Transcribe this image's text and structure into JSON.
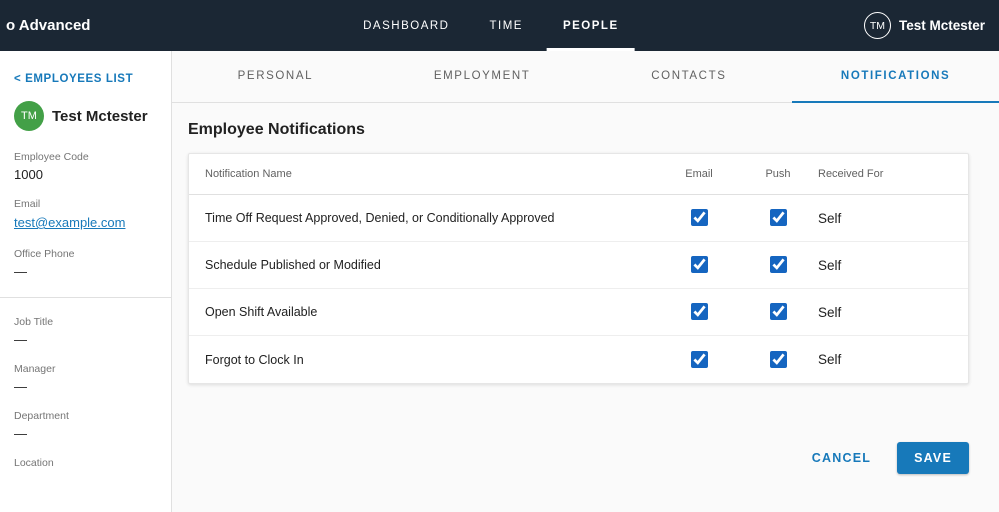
{
  "topbar": {
    "brand": "o Advanced",
    "nav": [
      {
        "label": "DASHBOARD",
        "active": false
      },
      {
        "label": "TIME",
        "active": false
      },
      {
        "label": "PEOPLE",
        "active": true
      }
    ],
    "user": {
      "initials": "TM",
      "name": "Test Mctester"
    }
  },
  "sidebar": {
    "back_link": "< EMPLOYEES LIST",
    "avatar_initials": "TM",
    "employee_name": "Test Mctester",
    "fields": [
      {
        "label": "Employee Code",
        "value": "1000"
      },
      {
        "label": "Email",
        "value": "test@example.com"
      },
      {
        "label": "Office Phone",
        "value": "—"
      },
      {
        "label": "Job Title",
        "value": "—"
      },
      {
        "label": "Manager",
        "value": "—"
      },
      {
        "label": "Department",
        "value": "—"
      },
      {
        "label": "Location",
        "value": ""
      }
    ]
  },
  "tabs": [
    {
      "label": "PERSONAL",
      "active": false
    },
    {
      "label": "EMPLOYMENT",
      "active": false
    },
    {
      "label": "CONTACTS",
      "active": false
    },
    {
      "label": "NOTIFICATIONS",
      "active": true
    }
  ],
  "content": {
    "heading": "Employee Notifications",
    "table": {
      "columns": {
        "name": "Notification Name",
        "email": "Email",
        "push": "Push",
        "received": "Received For"
      },
      "rows": [
        {
          "name": "Time Off Request Approved, Denied, or Conditionally Approved",
          "email": true,
          "push": true,
          "received": "Self"
        },
        {
          "name": "Schedule Published or Modified",
          "email": true,
          "push": true,
          "received": "Self"
        },
        {
          "name": "Open Shift Available",
          "email": true,
          "push": true,
          "received": "Self"
        },
        {
          "name": "Forgot to Clock In",
          "email": true,
          "push": true,
          "received": "Self"
        }
      ]
    },
    "actions": {
      "cancel": "CANCEL",
      "save": "SAVE"
    }
  },
  "colors": {
    "topbar_bg": "#1b2734",
    "accent_blue": "#1779ba",
    "checkbox_blue": "#1565c0",
    "avatar_green": "#43a047"
  }
}
